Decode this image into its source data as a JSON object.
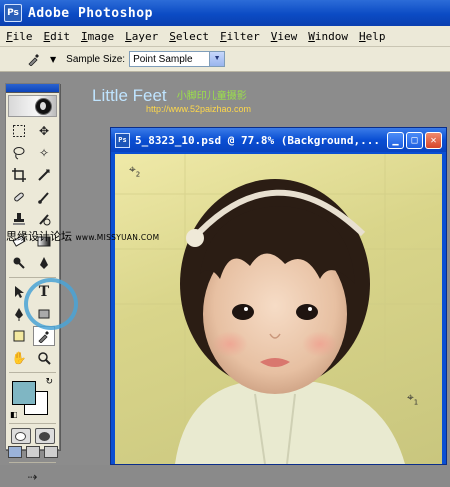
{
  "app": {
    "title": "Adobe Photoshop",
    "logo": "Ps"
  },
  "menu": [
    {
      "hot": "F",
      "rest": "ile"
    },
    {
      "hot": "E",
      "rest": "dit"
    },
    {
      "hot": "I",
      "rest": "mage"
    },
    {
      "hot": "L",
      "rest": "ayer"
    },
    {
      "hot": "S",
      "rest": "elect"
    },
    {
      "hot": "F",
      "rest": "ilter"
    },
    {
      "hot": "V",
      "rest": "iew"
    },
    {
      "hot": "W",
      "rest": "indow"
    },
    {
      "hot": "H",
      "rest": "elp"
    }
  ],
  "options": {
    "tool_icon": "eyedropper-icon",
    "sample_label": "Sample Size:",
    "sample_value": "Point Sample"
  },
  "brand": {
    "name": "Little Feet",
    "cn": "小脚印儿童摄影",
    "url": "http://www.52paizhao.com"
  },
  "watermark": {
    "text": "思缘设计论坛",
    "url": "www.MISSYUAN.COM"
  },
  "document": {
    "title": "5_8323_10.psd @ 77.8% (Background,..."
  },
  "markers": [
    {
      "symbol": "⌖",
      "num": "2"
    },
    {
      "symbol": "⌖",
      "num": "1"
    }
  ],
  "colors": {
    "foreground": "#7fb6c3",
    "background": "#ffffff",
    "titlebar": "#0a4ed3",
    "highlight": "#4aa3d6"
  }
}
